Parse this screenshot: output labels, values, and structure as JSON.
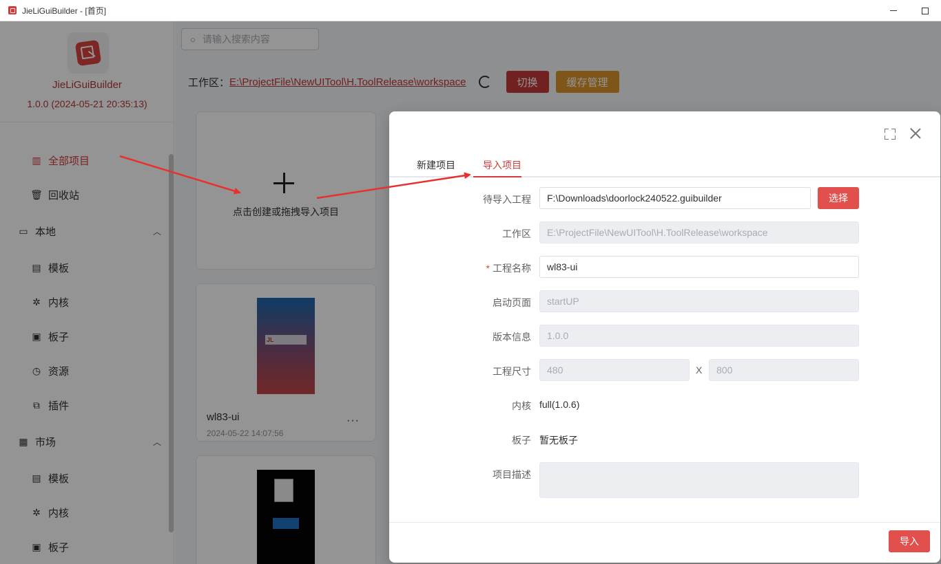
{
  "window": {
    "title": "JieLiGuiBuilder - [首页]"
  },
  "sidebar": {
    "app_name": "JieLiGuiBuilder",
    "app_version": "1.0.0 (2024-05-21 20:35:13)",
    "items": [
      {
        "label": "全部项目",
        "icon": "books-icon"
      },
      {
        "label": "回收站",
        "icon": "trash-icon"
      },
      {
        "label": "本地",
        "icon": "folder-icon"
      },
      {
        "label": "模板",
        "icon": "template-icon"
      },
      {
        "label": "内核",
        "icon": "core-icon"
      },
      {
        "label": "板子",
        "icon": "chip-icon"
      },
      {
        "label": "资源",
        "icon": "resource-icon"
      },
      {
        "label": "插件",
        "icon": "plugin-icon"
      },
      {
        "label": "市场",
        "icon": "store-icon"
      },
      {
        "label": "模板",
        "icon": "template-icon"
      },
      {
        "label": "内核",
        "icon": "core-icon"
      },
      {
        "label": "板子",
        "icon": "chip-icon"
      }
    ]
  },
  "main": {
    "search_placeholder": "请输入搜索内容",
    "workspace_label": "工作区：",
    "workspace_path": "E:\\ProjectFile\\NewUITool\\H.ToolRelease\\workspace",
    "switch_label": "切换",
    "cache_label": "缓存管理",
    "create_text": "点击创建或拖拽导入项目",
    "projects": [
      {
        "name": "wl83-ui",
        "date": "2024-05-22 14:07:56",
        "more": "···"
      }
    ]
  },
  "dialog": {
    "tabs": [
      "新建项目",
      "导入项目"
    ],
    "active_tab": "导入项目",
    "fields": {
      "import_project": {
        "label": "待导入工程",
        "value": "F:\\Downloads\\doorlock240522.guibuilder"
      },
      "select_label": "选择",
      "workspace": {
        "label": "工作区",
        "value": "E:\\ProjectFile\\NewUITool\\H.ToolRelease\\workspace"
      },
      "project_name": {
        "label": "工程名称",
        "required_mark": "*",
        "value": "wl83-ui"
      },
      "start_page": {
        "label": "启动页面",
        "value": "startUP"
      },
      "version": {
        "label": "版本信息",
        "value": "1.0.0"
      },
      "size": {
        "label": "工程尺寸",
        "width": "480",
        "height": "800",
        "separator": "X"
      },
      "core": {
        "label": "内核",
        "value": "full(1.0.6)"
      },
      "board": {
        "label": "板子",
        "value": "暂无板子"
      },
      "description": {
        "label": "项目描述",
        "value": ""
      }
    },
    "import_label": "导入"
  },
  "colors": {
    "accent": "#d13b3b",
    "warning": "#d9952a",
    "annotation_arrow": "#e8312f"
  }
}
